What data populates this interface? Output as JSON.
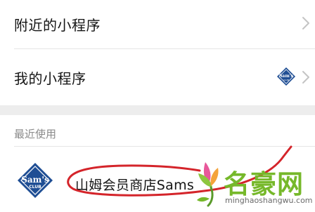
{
  "list": {
    "nearby_label": "附近的小程序",
    "mine_label": "我的小程序"
  },
  "recent": {
    "section_title": "最近使用",
    "items": [
      {
        "name": "山姆会员商店Sams C",
        "icon": "sams-club-logo"
      }
    ]
  },
  "logo_text": {
    "sams": "Sam's",
    "club": "CLUB"
  },
  "watermark": {
    "name": "名豪网",
    "url": "minghaoshangwu.com"
  },
  "colors": {
    "sams_blue": "#1f4e94",
    "annotation_red": "#d4242a",
    "watermark_green": "#76b82a",
    "section_gap": "#ededed"
  }
}
